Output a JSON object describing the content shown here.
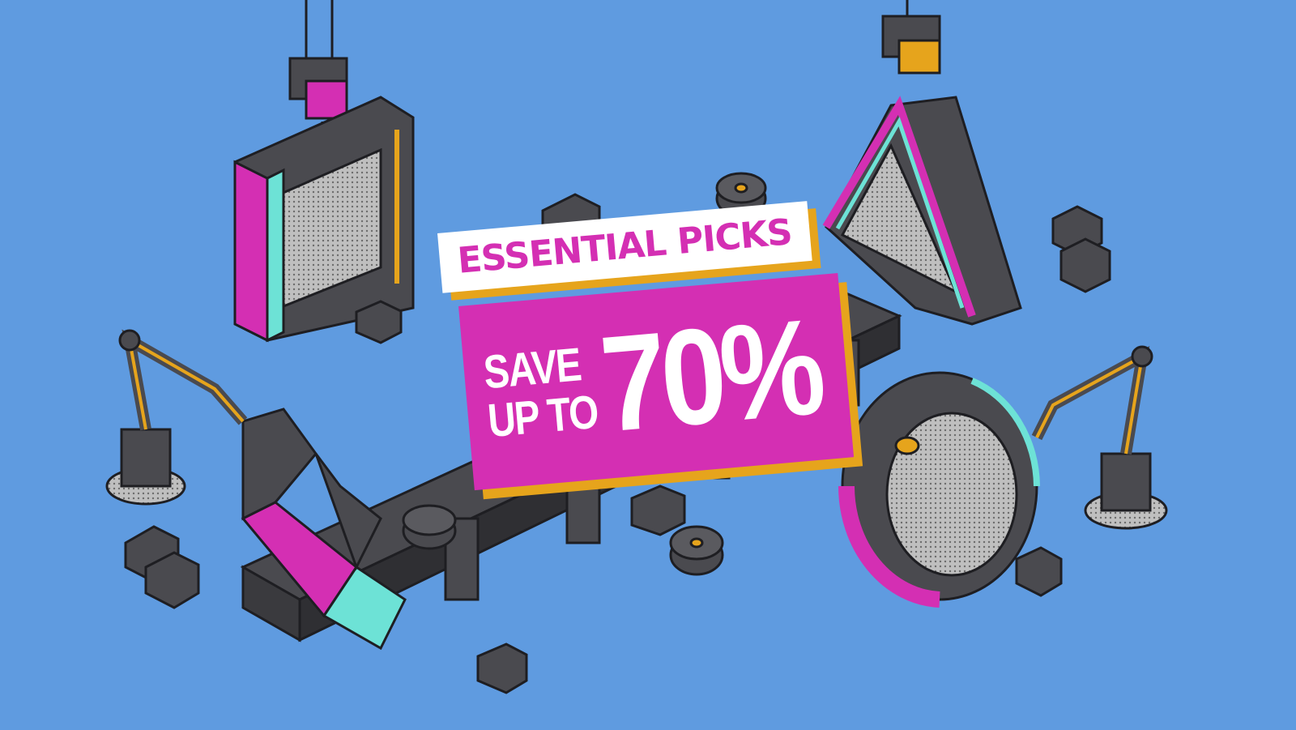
{
  "banner": {
    "headline": "ESSENTIAL PICKS",
    "save_line_1": "SAVE",
    "save_line_2": "UP TO",
    "discount": "70%"
  },
  "colors": {
    "background": "#5f9be0",
    "magenta": "#d42fb3",
    "cyan": "#6de2d6",
    "orange": "#e6a41c",
    "dark_gray": "#4a4a4f",
    "white": "#ffffff"
  },
  "decor": {
    "shapes": [
      "square-symbol",
      "triangle-symbol",
      "circle-symbol",
      "cross-symbol"
    ],
    "machines": [
      "crane-hook",
      "robot-arm",
      "conveyor-belt",
      "crate",
      "wheel"
    ]
  }
}
